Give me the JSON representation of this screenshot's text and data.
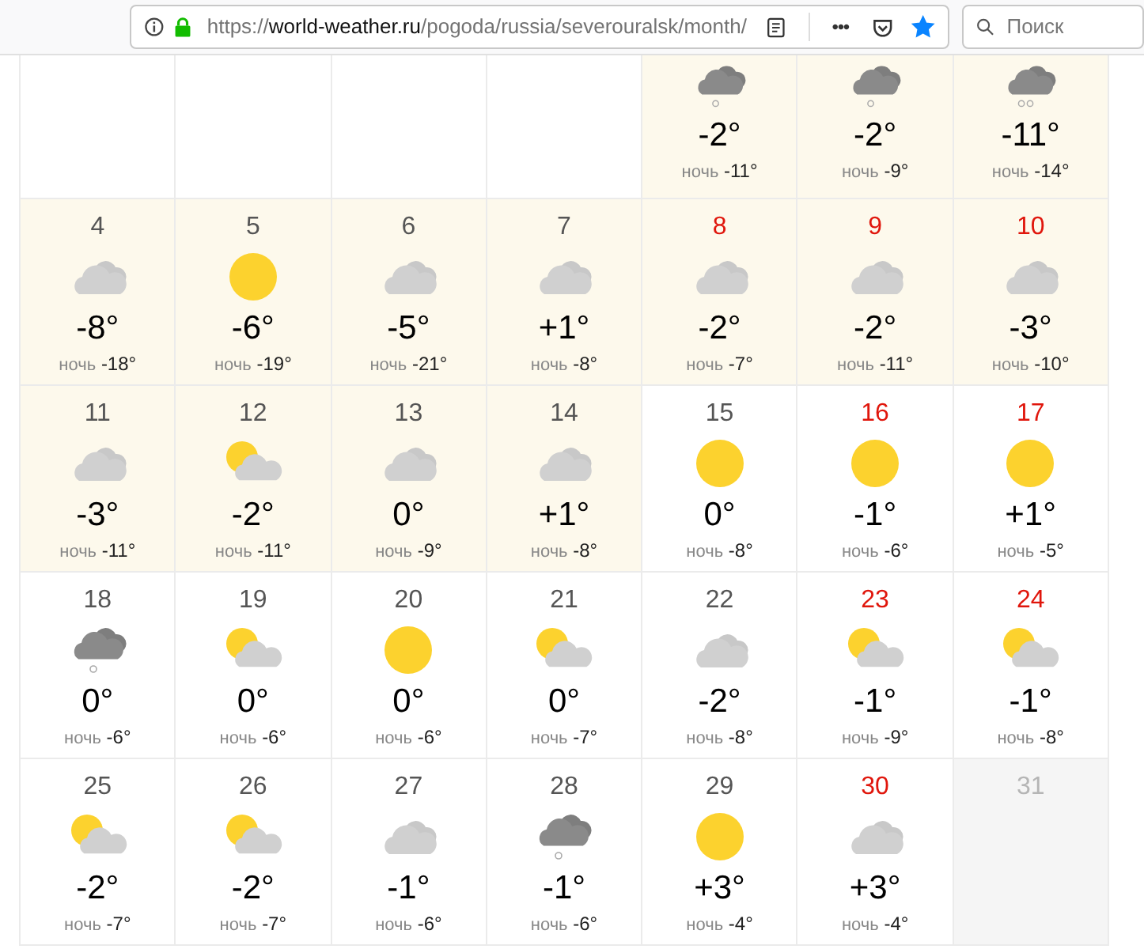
{
  "browser": {
    "url_scheme": "https://",
    "url_host": "world-weather.ru",
    "url_path": "/pogoda/russia/severouralsk/month/",
    "menu_glyph": "•••",
    "bookmarked": true,
    "search": {
      "placeholder": "Поиск"
    }
  },
  "weeks": [
    [
      {
        "kind": "blank"
      },
      {
        "kind": "blank"
      },
      {
        "kind": "blank"
      },
      {
        "kind": "blank"
      },
      {
        "kind": "day",
        "past": true,
        "icon": {
          "kind": "snow"
        },
        "day_temp": "-2°",
        "night_label": "ночь",
        "night_temp": "-11°"
      },
      {
        "kind": "day",
        "past": true,
        "icon": {
          "kind": "snow"
        },
        "day_temp": "-2°",
        "night_label": "ночь",
        "night_temp": "-9°"
      },
      {
        "kind": "day",
        "past": true,
        "icon": {
          "kind": "snowstorm"
        },
        "day_temp": "-11°",
        "night_label": "ночь",
        "night_temp": "-14°"
      }
    ],
    [
      {
        "kind": "day",
        "day": "4",
        "past": true,
        "weekend": false,
        "icon": {
          "kind": "cloud"
        },
        "day_temp": "-8°",
        "night_label": "ночь",
        "night_temp": "-18°"
      },
      {
        "kind": "day",
        "day": "5",
        "past": true,
        "weekend": false,
        "icon": {
          "kind": "sun"
        },
        "day_temp": "-6°",
        "night_label": "ночь",
        "night_temp": "-19°"
      },
      {
        "kind": "day",
        "day": "6",
        "past": true,
        "weekend": false,
        "icon": {
          "kind": "cloud"
        },
        "day_temp": "-5°",
        "night_label": "ночь",
        "night_temp": "-21°"
      },
      {
        "kind": "day",
        "day": "7",
        "past": true,
        "weekend": false,
        "icon": {
          "kind": "cloud"
        },
        "day_temp": "+1°",
        "night_label": "ночь",
        "night_temp": "-8°"
      },
      {
        "kind": "day",
        "day": "8",
        "past": true,
        "weekend": true,
        "icon": {
          "kind": "cloud"
        },
        "day_temp": "-2°",
        "night_label": "ночь",
        "night_temp": "-7°"
      },
      {
        "kind": "day",
        "day": "9",
        "past": true,
        "weekend": true,
        "icon": {
          "kind": "cloud"
        },
        "day_temp": "-2°",
        "night_label": "ночь",
        "night_temp": "-11°"
      },
      {
        "kind": "day",
        "day": "10",
        "past": true,
        "weekend": true,
        "icon": {
          "kind": "cloud"
        },
        "day_temp": "-3°",
        "night_label": "ночь",
        "night_temp": "-10°"
      }
    ],
    [
      {
        "kind": "day",
        "day": "11",
        "past": true,
        "weekend": false,
        "icon": {
          "kind": "cloud"
        },
        "day_temp": "-3°",
        "night_label": "ночь",
        "night_temp": "-11°"
      },
      {
        "kind": "day",
        "day": "12",
        "past": true,
        "weekend": false,
        "icon": {
          "kind": "partly"
        },
        "day_temp": "-2°",
        "night_label": "ночь",
        "night_temp": "-11°"
      },
      {
        "kind": "day",
        "day": "13",
        "past": true,
        "weekend": false,
        "icon": {
          "kind": "cloud"
        },
        "day_temp": "0°",
        "night_label": "ночь",
        "night_temp": "-9°"
      },
      {
        "kind": "day",
        "day": "14",
        "past": true,
        "weekend": false,
        "icon": {
          "kind": "cloud"
        },
        "day_temp": "+1°",
        "night_label": "ночь",
        "night_temp": "-8°"
      },
      {
        "kind": "day",
        "day": "15",
        "past": false,
        "weekend": false,
        "icon": {
          "kind": "sun"
        },
        "day_temp": "0°",
        "night_label": "ночь",
        "night_temp": "-8°"
      },
      {
        "kind": "day",
        "day": "16",
        "past": false,
        "weekend": true,
        "icon": {
          "kind": "sun"
        },
        "day_temp": "-1°",
        "night_label": "ночь",
        "night_temp": "-6°"
      },
      {
        "kind": "day",
        "day": "17",
        "past": false,
        "weekend": true,
        "icon": {
          "kind": "sun"
        },
        "day_temp": "+1°",
        "night_label": "ночь",
        "night_temp": "-5°"
      }
    ],
    [
      {
        "kind": "day",
        "day": "18",
        "past": false,
        "weekend": false,
        "icon": {
          "kind": "snow"
        },
        "day_temp": "0°",
        "night_label": "ночь",
        "night_temp": "-6°"
      },
      {
        "kind": "day",
        "day": "19",
        "past": false,
        "weekend": false,
        "icon": {
          "kind": "partly"
        },
        "day_temp": "0°",
        "night_label": "ночь",
        "night_temp": "-6°"
      },
      {
        "kind": "day",
        "day": "20",
        "past": false,
        "weekend": false,
        "icon": {
          "kind": "sun"
        },
        "day_temp": "0°",
        "night_label": "ночь",
        "night_temp": "-6°"
      },
      {
        "kind": "day",
        "day": "21",
        "past": false,
        "weekend": false,
        "icon": {
          "kind": "partly"
        },
        "day_temp": "0°",
        "night_label": "ночь",
        "night_temp": "-7°"
      },
      {
        "kind": "day",
        "day": "22",
        "past": false,
        "weekend": false,
        "icon": {
          "kind": "cloud"
        },
        "day_temp": "-2°",
        "night_label": "ночь",
        "night_temp": "-8°"
      },
      {
        "kind": "day",
        "day": "23",
        "past": false,
        "weekend": true,
        "icon": {
          "kind": "partly"
        },
        "day_temp": "-1°",
        "night_label": "ночь",
        "night_temp": "-9°"
      },
      {
        "kind": "day",
        "day": "24",
        "past": false,
        "weekend": true,
        "icon": {
          "kind": "partly"
        },
        "day_temp": "-1°",
        "night_label": "ночь",
        "night_temp": "-8°"
      }
    ],
    [
      {
        "kind": "day",
        "day": "25",
        "past": false,
        "weekend": false,
        "icon": {
          "kind": "partly"
        },
        "day_temp": "-2°",
        "night_label": "ночь",
        "night_temp": "-7°"
      },
      {
        "kind": "day",
        "day": "26",
        "past": false,
        "weekend": false,
        "icon": {
          "kind": "partly"
        },
        "day_temp": "-2°",
        "night_label": "ночь",
        "night_temp": "-7°"
      },
      {
        "kind": "day",
        "day": "27",
        "past": false,
        "weekend": false,
        "icon": {
          "kind": "cloud"
        },
        "day_temp": "-1°",
        "night_label": "ночь",
        "night_temp": "-6°"
      },
      {
        "kind": "day",
        "day": "28",
        "past": false,
        "weekend": false,
        "icon": {
          "kind": "snow"
        },
        "day_temp": "-1°",
        "night_label": "ночь",
        "night_temp": "-6°"
      },
      {
        "kind": "day",
        "day": "29",
        "past": false,
        "weekend": false,
        "icon": {
          "kind": "sun"
        },
        "day_temp": "+3°",
        "night_label": "ночь",
        "night_temp": "-4°"
      },
      {
        "kind": "day",
        "day": "30",
        "past": false,
        "weekend": true,
        "icon": {
          "kind": "cloud"
        },
        "day_temp": "+3°",
        "night_label": "ночь",
        "night_temp": "-4°"
      },
      {
        "kind": "unavailable",
        "day": "31"
      }
    ]
  ]
}
